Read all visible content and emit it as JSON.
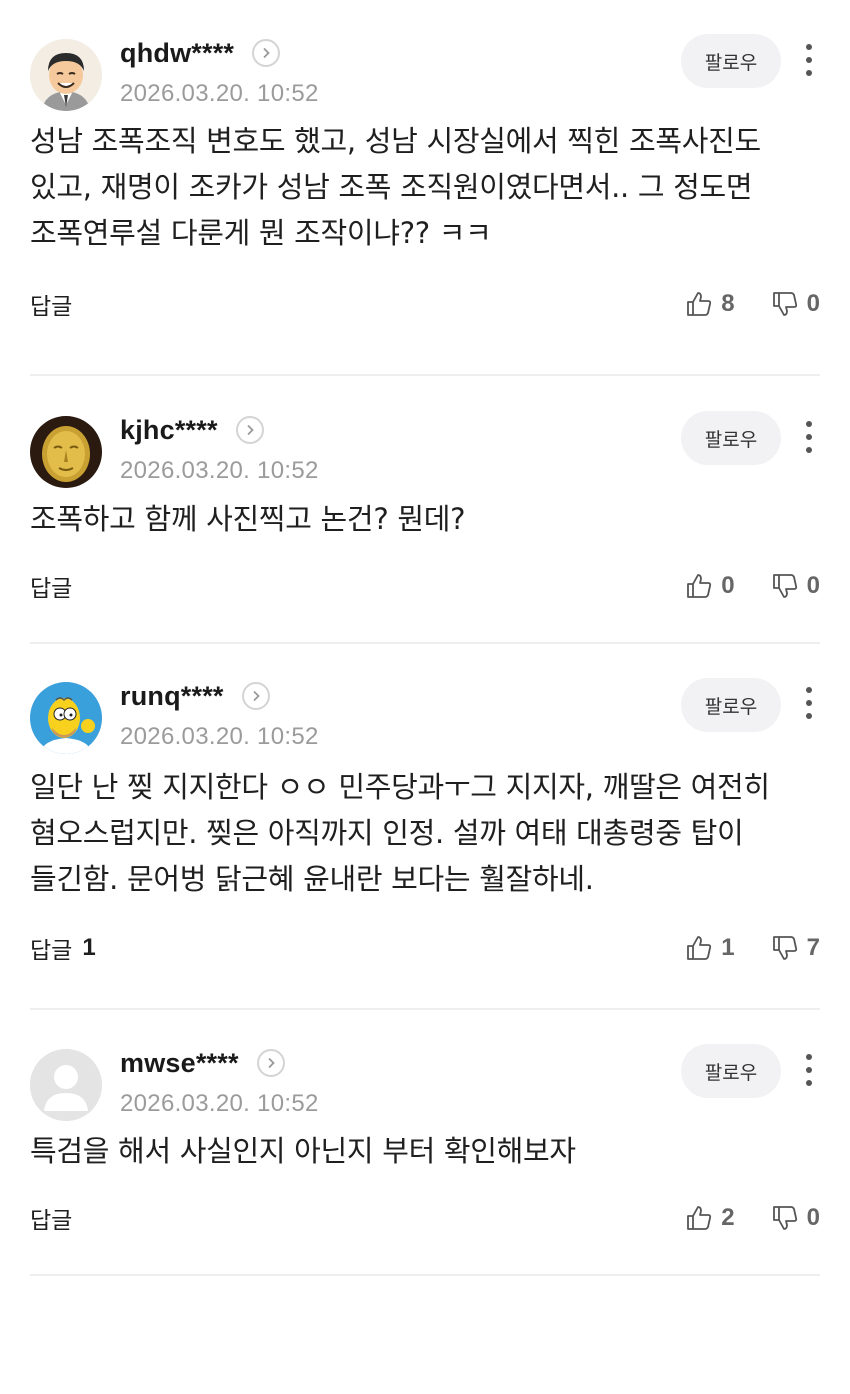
{
  "comments": [
    {
      "username": "qhdw****",
      "timestamp": "2026.03.20. 10:52",
      "follow_label": "팔로우",
      "body": "성남 조폭조직 변호도 했고, 성남 시장실에서 찍힌 조폭사진도 있고, 재명이 조카가 성남 조폭 조직원이였다면서.. 그 정도면 조폭연루설 다룬게 뭔 조작이냐?? ㅋㅋ",
      "reply_label": "답글",
      "reply_count": "",
      "likes": "8",
      "dislikes": "0",
      "avatar_icon": "cartoon-man-avatar"
    },
    {
      "username": "kjhc****",
      "timestamp": "2026.03.20. 10:52",
      "follow_label": "팔로우",
      "body": "조폭하고 함께 사진찍고 논건? 뭔데?",
      "reply_label": "답글",
      "reply_count": "",
      "likes": "0",
      "dislikes": "0",
      "avatar_icon": "golden-mask-avatar"
    },
    {
      "username": "runq****",
      "timestamp": "2026.03.20. 10:52",
      "follow_label": "팔로우",
      "body": "일단 난 찢 지지한다 ㅇㅇ 민주당과ㅜ그 지지자, 깨딸은 여전히 혐오스럽지만. 찢은 아직까지 인정. 설까 여태 대총령중 탑이 들긴함. 문어벙 닭근혜 윤내란 보다는 훨잘하네.",
      "reply_label": "답글",
      "reply_count": "1",
      "likes": "1",
      "dislikes": "7",
      "avatar_icon": "homer-simpson-avatar"
    },
    {
      "username": "mwse****",
      "timestamp": "2026.03.20. 10:52",
      "follow_label": "팔로우",
      "body": "특검을 해서 사실인지 아닌지 부터 확인해보자",
      "reply_label": "답글",
      "reply_count": "",
      "likes": "2",
      "dislikes": "0",
      "avatar_icon": "default-user-avatar"
    }
  ],
  "colors": {
    "text": "#1f1f1f",
    "meta": "#9b9b9b",
    "follow_bg": "#f2f2f4",
    "divider": "#eeeeee"
  }
}
